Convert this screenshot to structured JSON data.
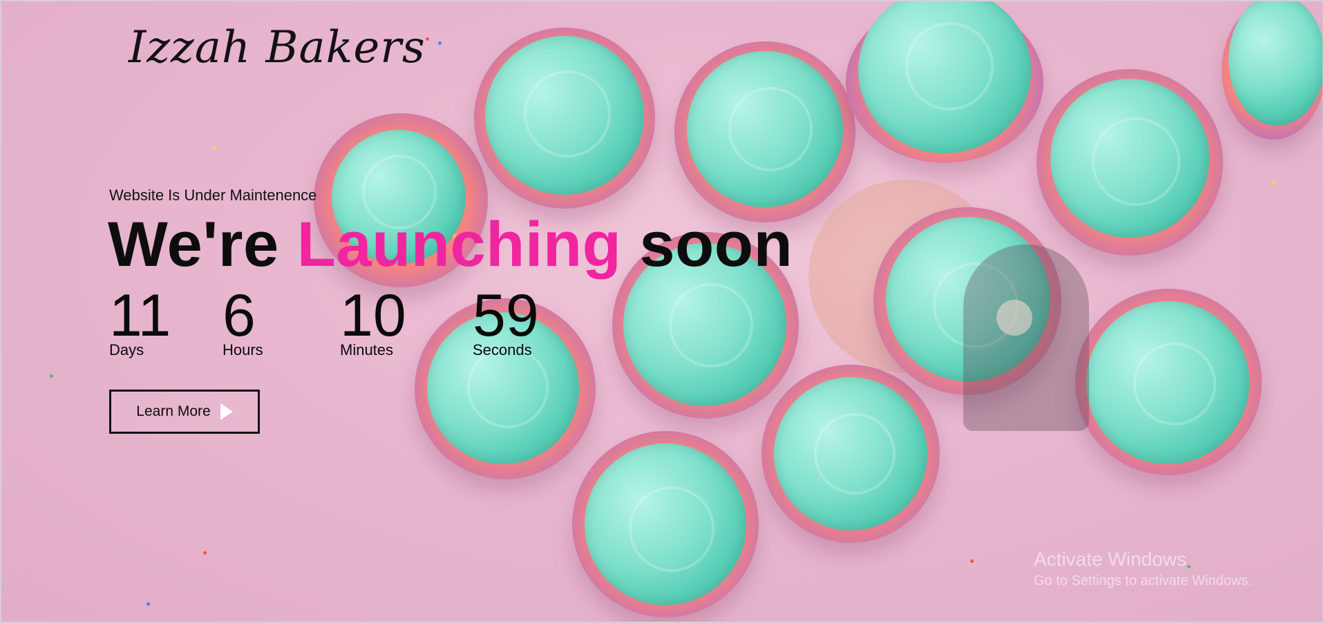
{
  "brand": {
    "name": "Izzah Bakers"
  },
  "hero": {
    "eyebrow": "Website Is Under Maintenence",
    "headline": {
      "part1": "We're",
      "accent": "Launching",
      "part2": "soon"
    },
    "countdown": [
      {
        "value": "11",
        "label": "Days"
      },
      {
        "value": "6",
        "label": "Hours"
      },
      {
        "value": "10",
        "label": "Minutes"
      },
      {
        "value": "59",
        "label": "Seconds"
      }
    ],
    "cta": {
      "label": "Learn More",
      "icon": "play-icon"
    }
  },
  "system": {
    "activation_title": "Activate Windows",
    "activation_subtitle": "Go to Settings to activate Windows."
  },
  "colors": {
    "accent": "#f0259f",
    "background": "#e8b7cf",
    "frosting": "#7fe0cb"
  }
}
